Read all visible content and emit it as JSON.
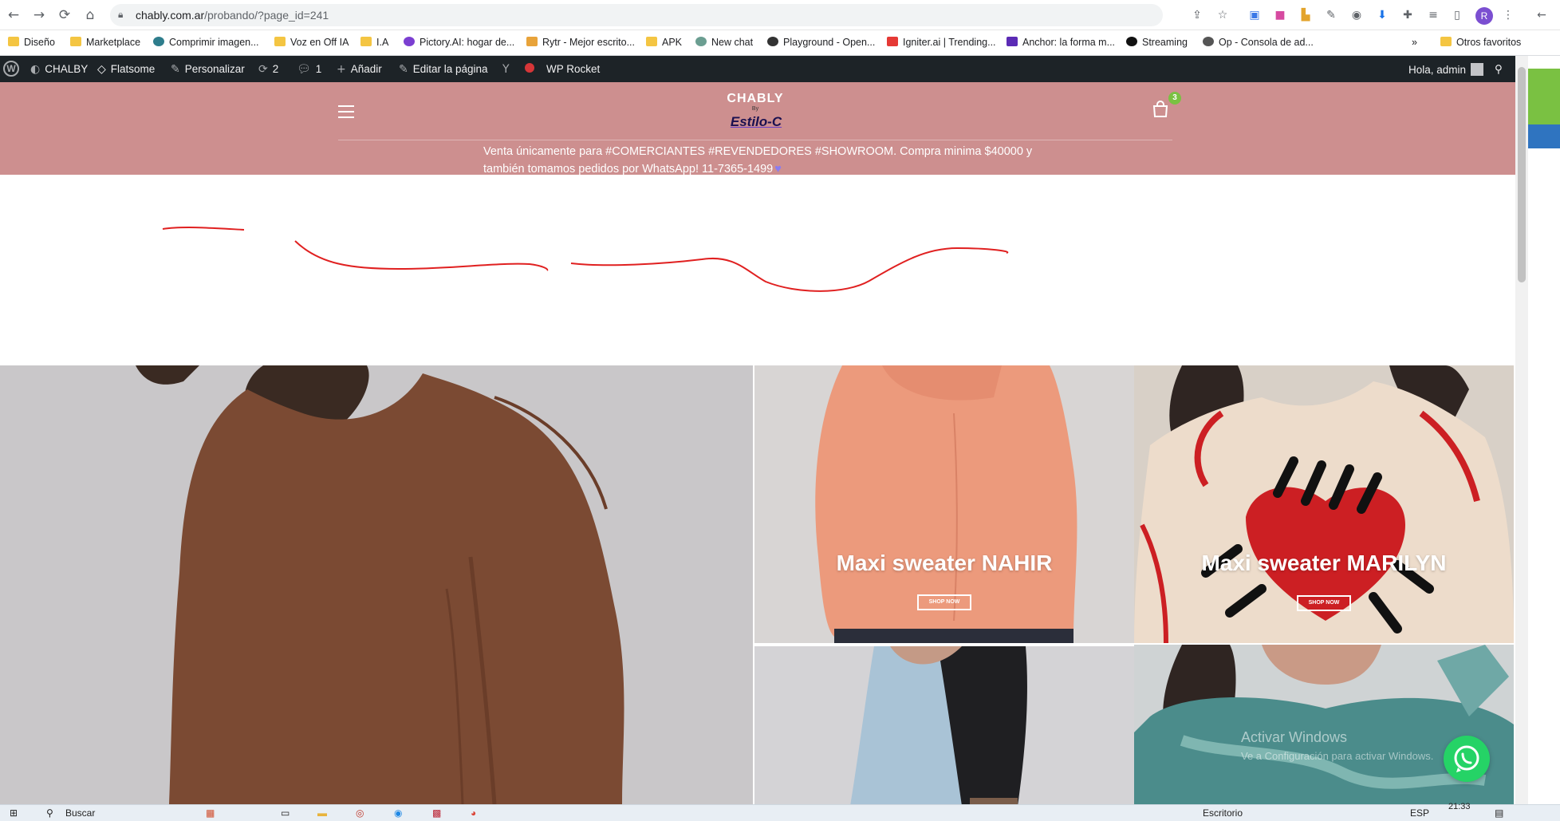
{
  "browser": {
    "url_host": "chably.com.ar",
    "url_path": "/probando/?page_id=241",
    "profile_initial": "R"
  },
  "bookmarks": [
    {
      "label": "Diseño",
      "color": "#f4c542"
    },
    {
      "label": "Marketplace",
      "color": "#f4c542"
    },
    {
      "label": "Comprimir imagen...",
      "color": "#2e7d8c"
    },
    {
      "label": "Voz en Off IA",
      "color": "#f4c542"
    },
    {
      "label": "I.A",
      "color": "#f4c542"
    },
    {
      "label": "Pictory.AI: hogar de...",
      "color": "#7b3fd1"
    },
    {
      "label": "Rytr - Mejor escrito...",
      "color": "#e8a33a"
    },
    {
      "label": "APK",
      "color": "#f4c542"
    },
    {
      "label": "New chat",
      "color": "#6b9e91"
    },
    {
      "label": "Playground - Open...",
      "color": "#333333"
    },
    {
      "label": "Igniter.ai | Trending...",
      "color": "#e53935"
    },
    {
      "label": "Anchor: la forma m...",
      "color": "#5b2bb5"
    },
    {
      "label": "Streaming",
      "color": "#111111"
    },
    {
      "label": "Op - Consola de ad...",
      "color": "#555555"
    }
  ],
  "bookmarks_more": "»",
  "bookmarks_other": "Otros favoritos",
  "wpbar": {
    "site": "CHALBY",
    "theme": "Flatsome",
    "customize": "Personalizar",
    "updates": "2",
    "comments": "1",
    "add_new": "Añadir",
    "edit_page": "Editar la página",
    "rocket": "WP Rocket",
    "greeting": "Hola, admin"
  },
  "site": {
    "logo_top": "CHABLY",
    "logo_by": "By",
    "logo_bottom": "Estilo-C",
    "cart_count": "3",
    "notice_line1": "Venta únicamente para #COMERCIANTES #REVENDEDORES #SHOWROOM. Compra minima $40000 y",
    "notice_line2": "también tomamos pedidos por WhatsApp! 11-7365-1499"
  },
  "tiles": [
    {
      "title": "Maxi sweater NAHIR",
      "button": "SHOP NOW"
    },
    {
      "title": "Maxi sweater MARILYN",
      "button": "SHOP NOW"
    }
  ],
  "watermark": {
    "line1": "Activar Windows",
    "line2": "Ve a Configuración para activar Windows."
  },
  "taskbar": {
    "search": "Buscar",
    "desktop": "Escritorio",
    "lang": "ESP",
    "time": "21:33"
  },
  "colors": {
    "header_bg": "#cd8f8f",
    "wpbar_bg": "#1d2327",
    "cart_badge": "#7ac142",
    "whatsapp": "#25d366"
  }
}
